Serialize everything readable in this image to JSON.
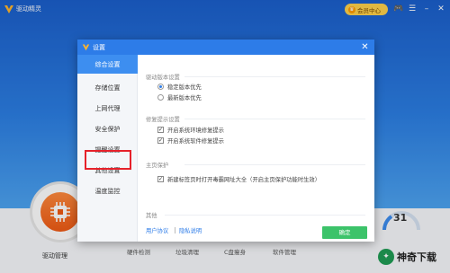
{
  "app": {
    "title": "驱动精灵",
    "vip_label": "会员中心",
    "driver_mgr_label": "驱动管理",
    "nav": [
      "硬件检测",
      "垃圾清理",
      "C盘瘦身",
      "软件管理"
    ],
    "gauge_value": "31",
    "brand_text": "神奇下载"
  },
  "dialog": {
    "title": "设置",
    "close_icon": "close-icon",
    "sidebar": [
      {
        "label": "综合设置",
        "active": true
      },
      {
        "label": "存储位置",
        "active": false
      },
      {
        "label": "上网代理",
        "active": false
      },
      {
        "label": "安全保护",
        "active": false
      },
      {
        "label": "提醒设置",
        "active": false
      },
      {
        "label": "其他设置",
        "active": false
      },
      {
        "label": "温度监控",
        "active": false
      }
    ],
    "sections": {
      "driver_version": {
        "title": "驱动版本设置",
        "options": [
          {
            "label": "稳定版本优先",
            "selected": true
          },
          {
            "label": "最新版本优先",
            "selected": false
          }
        ]
      },
      "repair_tips": {
        "title": "修复提示设置",
        "options": [
          {
            "label": "开启系统环境修复提示",
            "checked": true
          },
          {
            "label": "开启系统软件修复提示",
            "checked": true
          }
        ]
      },
      "homepage": {
        "title": "主页保护",
        "options": [
          {
            "label": "新建标签页时打开毒霸网址大全（开启主页保护功能时生效）",
            "checked": true
          }
        ]
      },
      "other": {
        "title": "其他",
        "links": [
          "用户协议",
          "隐私说明"
        ]
      }
    },
    "confirm_label": "确定"
  },
  "colors": {
    "title_blue": "#2d7ce8",
    "active_blue": "#3d8ef0",
    "confirm_green": "#3cc36a",
    "highlight_red": "#e6212a"
  }
}
